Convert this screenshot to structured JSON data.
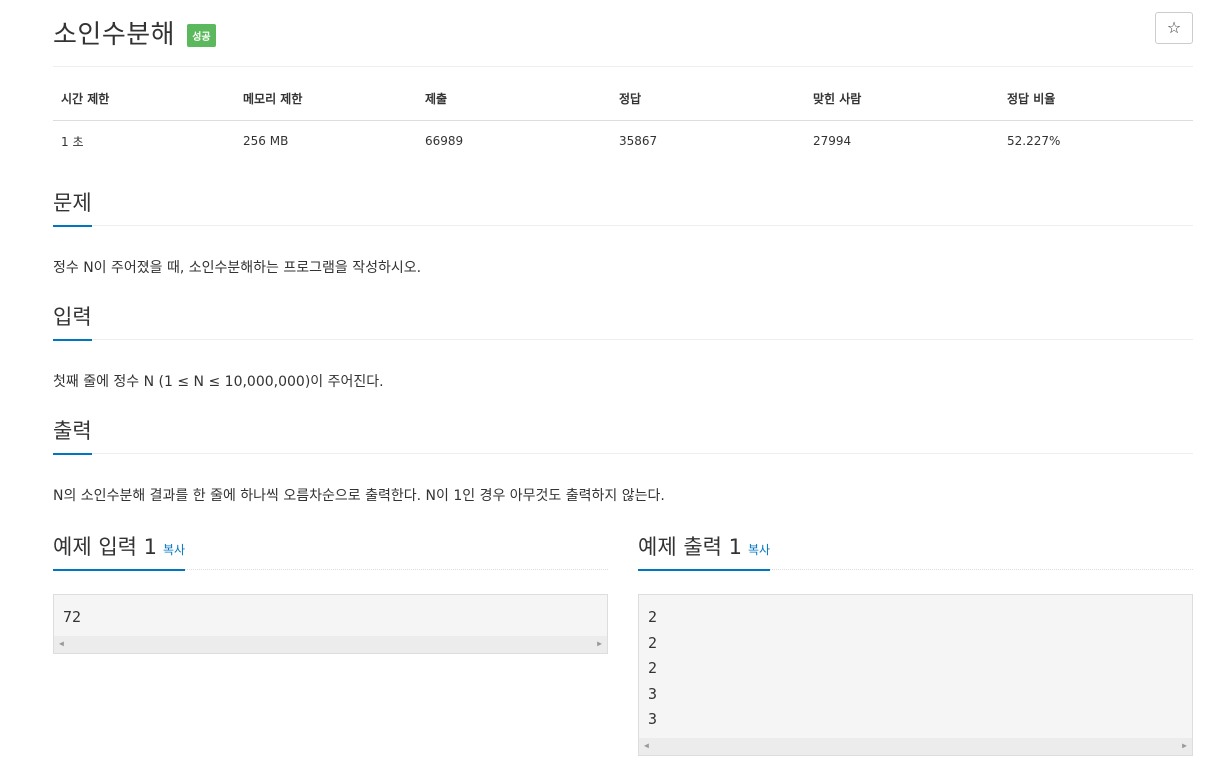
{
  "problem": {
    "title": "소인수분해",
    "badge": "성공",
    "star": "☆"
  },
  "info": {
    "headers": [
      "시간 제한",
      "메모리 제한",
      "제출",
      "정답",
      "맞힌 사람",
      "정답 비율"
    ],
    "values": [
      "1 초",
      "256 MB",
      "66989",
      "35867",
      "27994",
      "52.227%"
    ]
  },
  "sections": {
    "problem_heading": "문제",
    "problem_text": "정수 N이 주어졌을 때, 소인수분해하는 프로그램을 작성하시오.",
    "input_heading": "입력",
    "input_text": "첫째 줄에 정수 N (1 ≤ N ≤ 10,000,000)이 주어진다.",
    "output_heading": "출력",
    "output_text": "N의 소인수분해 결과를 한 줄에 하나씩 오름차순으로 출력한다. N이 1인 경우 아무것도 출력하지 않는다."
  },
  "examples": {
    "input_heading": "예제 입력 1",
    "output_heading": "예제 출력 1",
    "copy_label": "복사",
    "input_lines": [
      "72"
    ],
    "output_lines": [
      "2",
      "2",
      "2",
      "3",
      "3"
    ]
  },
  "colors": {
    "accent": "#0076c0",
    "badge_green": "#5cb85c"
  },
  "icons": {
    "star": "star-icon",
    "scroll_left": "scroll-left-arrow-icon",
    "scroll_right": "scroll-right-arrow-icon"
  }
}
